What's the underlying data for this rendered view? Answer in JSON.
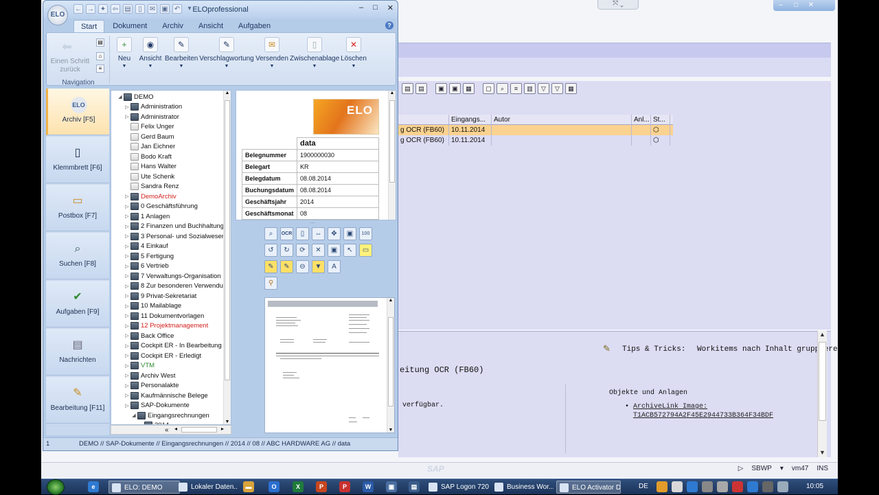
{
  "elo": {
    "title": "ELOprofessional",
    "logo": "ELO",
    "tabs": [
      "Start",
      "Dokument",
      "Archiv",
      "Ansicht",
      "Aufgaben"
    ],
    "active_tab": "Start",
    "ribbon": {
      "back_label": "Einen Schritt zurück",
      "nav_group": "Navigation",
      "buttons": [
        {
          "label": "Neu",
          "icon": "new-icon"
        },
        {
          "label": "Ansicht",
          "icon": "eye-icon"
        },
        {
          "label": "Bearbeiten",
          "icon": "edit-icon"
        },
        {
          "label": "Verschlagwortung",
          "icon": "keyword-icon"
        },
        {
          "label": "Versenden",
          "icon": "envelope-icon"
        },
        {
          "label": "Zwischenablage",
          "icon": "clipboard-icon"
        },
        {
          "label": "Löschen",
          "icon": "delete-icon"
        }
      ]
    },
    "sidebar": [
      {
        "label": "Archiv [F5]",
        "icon": "archive-icon"
      },
      {
        "label": "Klemmbrett [F6]",
        "icon": "clipboard-icon"
      },
      {
        "label": "Postbox [F7]",
        "icon": "inbox-icon"
      },
      {
        "label": "Suchen [F8]",
        "icon": "search-icon"
      },
      {
        "label": "Aufgaben [F9]",
        "icon": "checkmark-icon"
      },
      {
        "label": "Nachrichten",
        "icon": "message-icon"
      },
      {
        "label": "Bearbeitung [F11]",
        "icon": "pencil-icon"
      }
    ],
    "tree": [
      {
        "label": "DEMO",
        "level": 0,
        "style": "root"
      },
      {
        "label": "Administration",
        "level": 1
      },
      {
        "label": "Administrator",
        "level": 1
      },
      {
        "label": "Felix Unger",
        "level": 1,
        "light": true
      },
      {
        "label": "Gerd Baum",
        "level": 1,
        "light": true
      },
      {
        "label": "Jan Eichner",
        "level": 1,
        "light": true
      },
      {
        "label": "Bodo Kraft",
        "level": 1,
        "light": true
      },
      {
        "label": "Hans Walter",
        "level": 1,
        "light": true
      },
      {
        "label": "Ute Schenk",
        "level": 1,
        "light": true
      },
      {
        "label": "Sandra Renz",
        "level": 1,
        "light": true
      },
      {
        "label": "DemoArchiv",
        "level": 1,
        "style": "red"
      },
      {
        "label": "0 Geschäftsführung",
        "level": 1
      },
      {
        "label": "1 Anlagen",
        "level": 1
      },
      {
        "label": "2 Finanzen und Buchhaltung",
        "level": 1
      },
      {
        "label": "3 Personal- und Sozialwesen",
        "level": 1
      },
      {
        "label": "4 Einkauf",
        "level": 1
      },
      {
        "label": "5 Fertigung",
        "level": 1
      },
      {
        "label": "6 Vertrieb",
        "level": 1
      },
      {
        "label": "7 Verwaltungs-Organisation",
        "level": 1
      },
      {
        "label": "8 Zur besonderen Verwendun",
        "level": 1
      },
      {
        "label": "9 Privat-Sekretariat",
        "level": 1
      },
      {
        "label": "10 Mailablage",
        "level": 1
      },
      {
        "label": "11 Dokumentvorlagen",
        "level": 1
      },
      {
        "label": "12 Projektmanagement",
        "level": 1,
        "style": "red"
      },
      {
        "label": "Back Office",
        "level": 1
      },
      {
        "label": "Cockpit ER - In Bearbeitung",
        "level": 1
      },
      {
        "label": "Cockpit ER - Erledigt",
        "level": 1
      },
      {
        "label": "VTM",
        "level": 1,
        "style": "green"
      },
      {
        "label": "Archiv West",
        "level": 1
      },
      {
        "label": "Personalakte",
        "level": 1
      },
      {
        "label": "Kaufmännische Belege",
        "level": 1
      },
      {
        "label": "SAP-Dokumente",
        "level": 1
      },
      {
        "label": "Eingangsrechnungen",
        "level": 2
      },
      {
        "label": "2014",
        "level": 3
      }
    ],
    "preview": {
      "brand": "ELO",
      "header": "data",
      "rows": [
        {
          "key": "Belegnummer",
          "value": "1900000030"
        },
        {
          "key": "Belegart",
          "value": "KR"
        },
        {
          "key": "Belegdatum",
          "value": "08.08.2014"
        },
        {
          "key": "Buchungsdatum",
          "value": "08.08.2014"
        },
        {
          "key": "Geschäftsjahr",
          "value": "2014"
        },
        {
          "key": "Geschäftsmonat",
          "value": "08"
        }
      ]
    },
    "image_tools": {
      "ocr": "OCR",
      "fit": "100"
    },
    "status": {
      "left": "1",
      "path": "DEMO // SAP-Dokumente // Eingangsrechnungen // 2014 // 08 // ABC HARDWARE AG // data"
    },
    "tree_hscroll_left": "«"
  },
  "sap": {
    "table": {
      "headers": [
        "",
        "Eingangs...",
        "Autor",
        "Anl...",
        "St..."
      ],
      "rows": [
        {
          "text": "g OCR (FB60)",
          "date": "10.11.2014",
          "selected": true
        },
        {
          "text": "g OCR (FB60)",
          "date": "10.11.2014",
          "selected": false
        }
      ]
    },
    "tips_label": "Tips & Tricks:",
    "tips_text": "Workitems nach Inhalt gruppieren...",
    "heading": "eitung OCR (FB60)",
    "available_text": "verfügbar.",
    "objects_title": "Objekte und Anlagen",
    "archivelink_label": "ArchiveLink Image:",
    "archivelink_id": "T1ACB572794A2F45E2944733B364F34BDF",
    "status": {
      "system": "SBWP",
      "host": "vm47",
      "mode": "INS",
      "logo": "SAP"
    }
  },
  "taskbar": {
    "items": [
      {
        "label": "ELO: DEMO",
        "active": true
      },
      {
        "label": "Lokaler Daten...",
        "active": false
      },
      {
        "label": "SAP Logon 720",
        "active": false
      },
      {
        "label": "Business Wor...",
        "active": false
      },
      {
        "label": "ELO Activator D...",
        "active": true
      }
    ],
    "lang": "DE",
    "time": "10:05"
  }
}
